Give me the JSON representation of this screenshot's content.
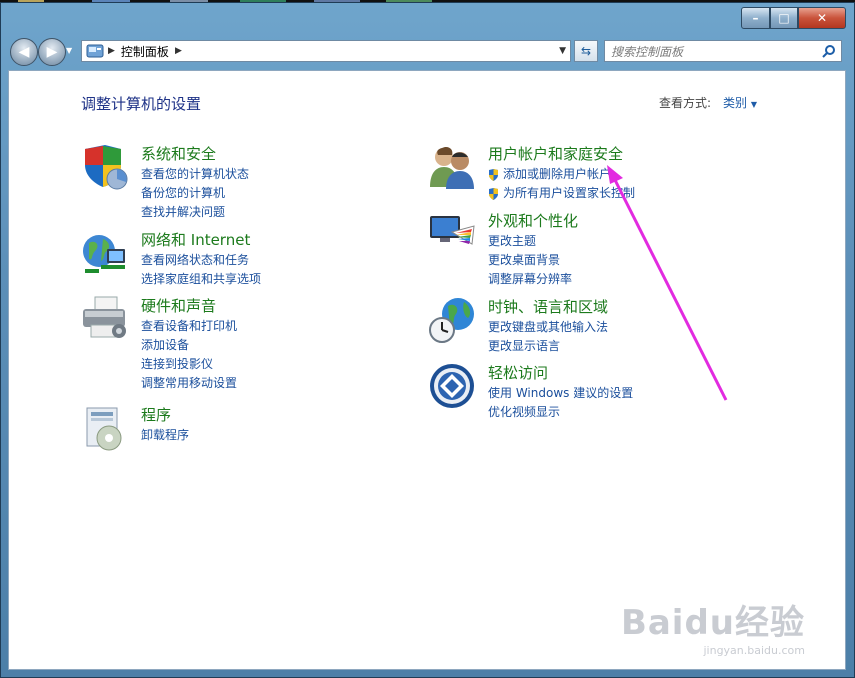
{
  "window": {
    "caption_buttons": {
      "minimize": "–",
      "maximize": "□",
      "close": "✕"
    }
  },
  "navbar": {
    "back_icon": "back-arrow-icon",
    "forward_icon": "forward-arrow-icon",
    "breadcrumb": "控制面板",
    "search_placeholder": "搜索控制面板"
  },
  "header": {
    "title": "调整计算机的设置",
    "view_by_label": "查看方式:",
    "view_by_value": "类别"
  },
  "categories": [
    {
      "title": "系统和安全",
      "icon": "shield-icon",
      "links": [
        "查看您的计算机状态",
        "备份您的计算机",
        "查找并解决问题"
      ]
    },
    {
      "title": "网络和 Internet",
      "icon": "network-globe-icon",
      "links": [
        "查看网络状态和任务",
        "选择家庭组和共享选项"
      ]
    },
    {
      "title": "硬件和声音",
      "icon": "printer-icon",
      "links": [
        "查看设备和打印机",
        "添加设备",
        "连接到投影仪",
        "调整常用移动设置"
      ]
    },
    {
      "title": "程序",
      "icon": "programs-icon",
      "links": [
        "卸载程序"
      ]
    },
    {
      "title": "用户帐户和家庭安全",
      "icon": "users-icon",
      "links": [
        "添加或删除用户帐户",
        "为所有用户设置家长控制"
      ]
    },
    {
      "title": "外观和个性化",
      "icon": "display-palette-icon",
      "links": [
        "更改主题",
        "更改桌面背景",
        "调整屏幕分辨率"
      ]
    },
    {
      "title": "时钟、语言和区域",
      "icon": "clock-globe-icon",
      "links": [
        "更改键盘或其他输入法",
        "更改显示语言"
      ]
    },
    {
      "title": "轻松访问",
      "icon": "ease-of-access-icon",
      "links": [
        "使用 Windows 建议的设置",
        "优化视频显示"
      ]
    }
  ],
  "watermark": {
    "brand": "Baidu经验",
    "url": "jingyan.baidu.com"
  },
  "colors": {
    "link": "#1b4f9c",
    "category_title": "#1c7a1c",
    "heading": "#1e3287",
    "annotation_arrow": "#e22be0"
  }
}
